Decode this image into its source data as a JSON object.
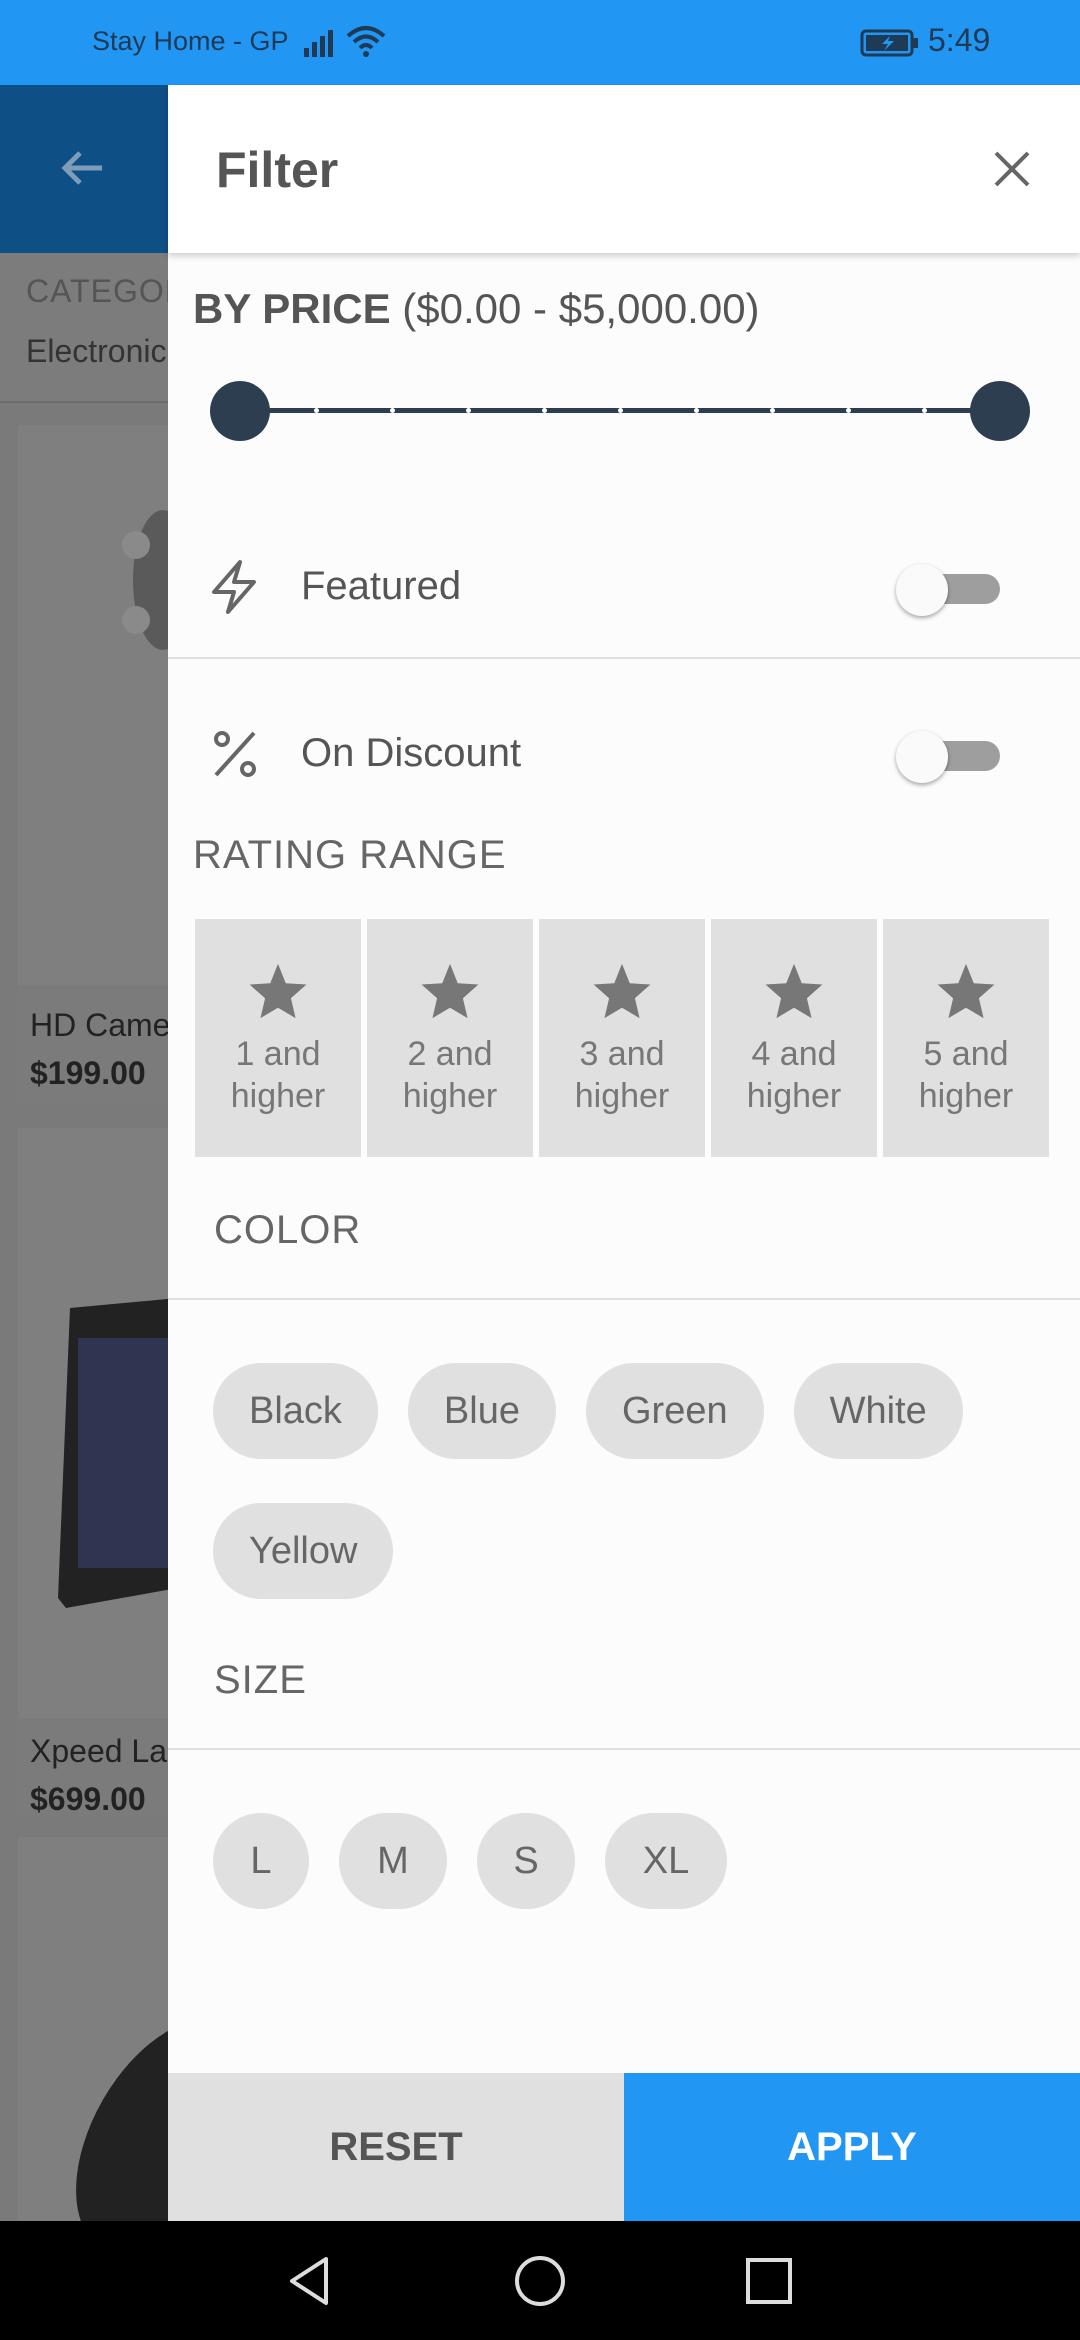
{
  "status_bar": {
    "carrier": "Stay Home - GP",
    "time": "5:49",
    "icons": [
      "signal-icon",
      "wifi-icon",
      "battery-charging-icon"
    ]
  },
  "background_page": {
    "category_label": "CATEGOR",
    "category_value": "Electronic",
    "products": [
      {
        "name": "HD Came",
        "price": "$199.00"
      },
      {
        "name": "Xpeed La",
        "price": "$699.00"
      }
    ]
  },
  "filter": {
    "title": "Filter",
    "price": {
      "label": "BY PRICE",
      "range_text": "($0.00 - $5,000.00)",
      "min": 0,
      "max": 5000,
      "selected_min": 0,
      "selected_max": 5000,
      "divisions": 10
    },
    "toggles": [
      {
        "label": "Featured",
        "icon": "bolt-icon",
        "on": false
      },
      {
        "label": "On Discount",
        "icon": "percent-icon",
        "on": false
      }
    ],
    "rating": {
      "title": "RATING RANGE",
      "options": [
        {
          "line1": "1 and",
          "line2": "higher"
        },
        {
          "line1": "2 and",
          "line2": "higher"
        },
        {
          "line1": "3 and",
          "line2": "higher"
        },
        {
          "line1": "4 and",
          "line2": "higher"
        },
        {
          "line1": "5 and",
          "line2": "higher"
        }
      ]
    },
    "color": {
      "title": "COLOR",
      "options": [
        "Black",
        "Blue",
        "Green",
        "White",
        "Yellow"
      ]
    },
    "size": {
      "title": "SIZE",
      "options": [
        "L",
        "M",
        "S",
        "XL"
      ]
    },
    "reset_label": "RESET",
    "apply_label": "APPLY"
  },
  "colors": {
    "accent": "#2196F3",
    "slider": "#2c3e50",
    "chip": "#e0e0e0"
  }
}
